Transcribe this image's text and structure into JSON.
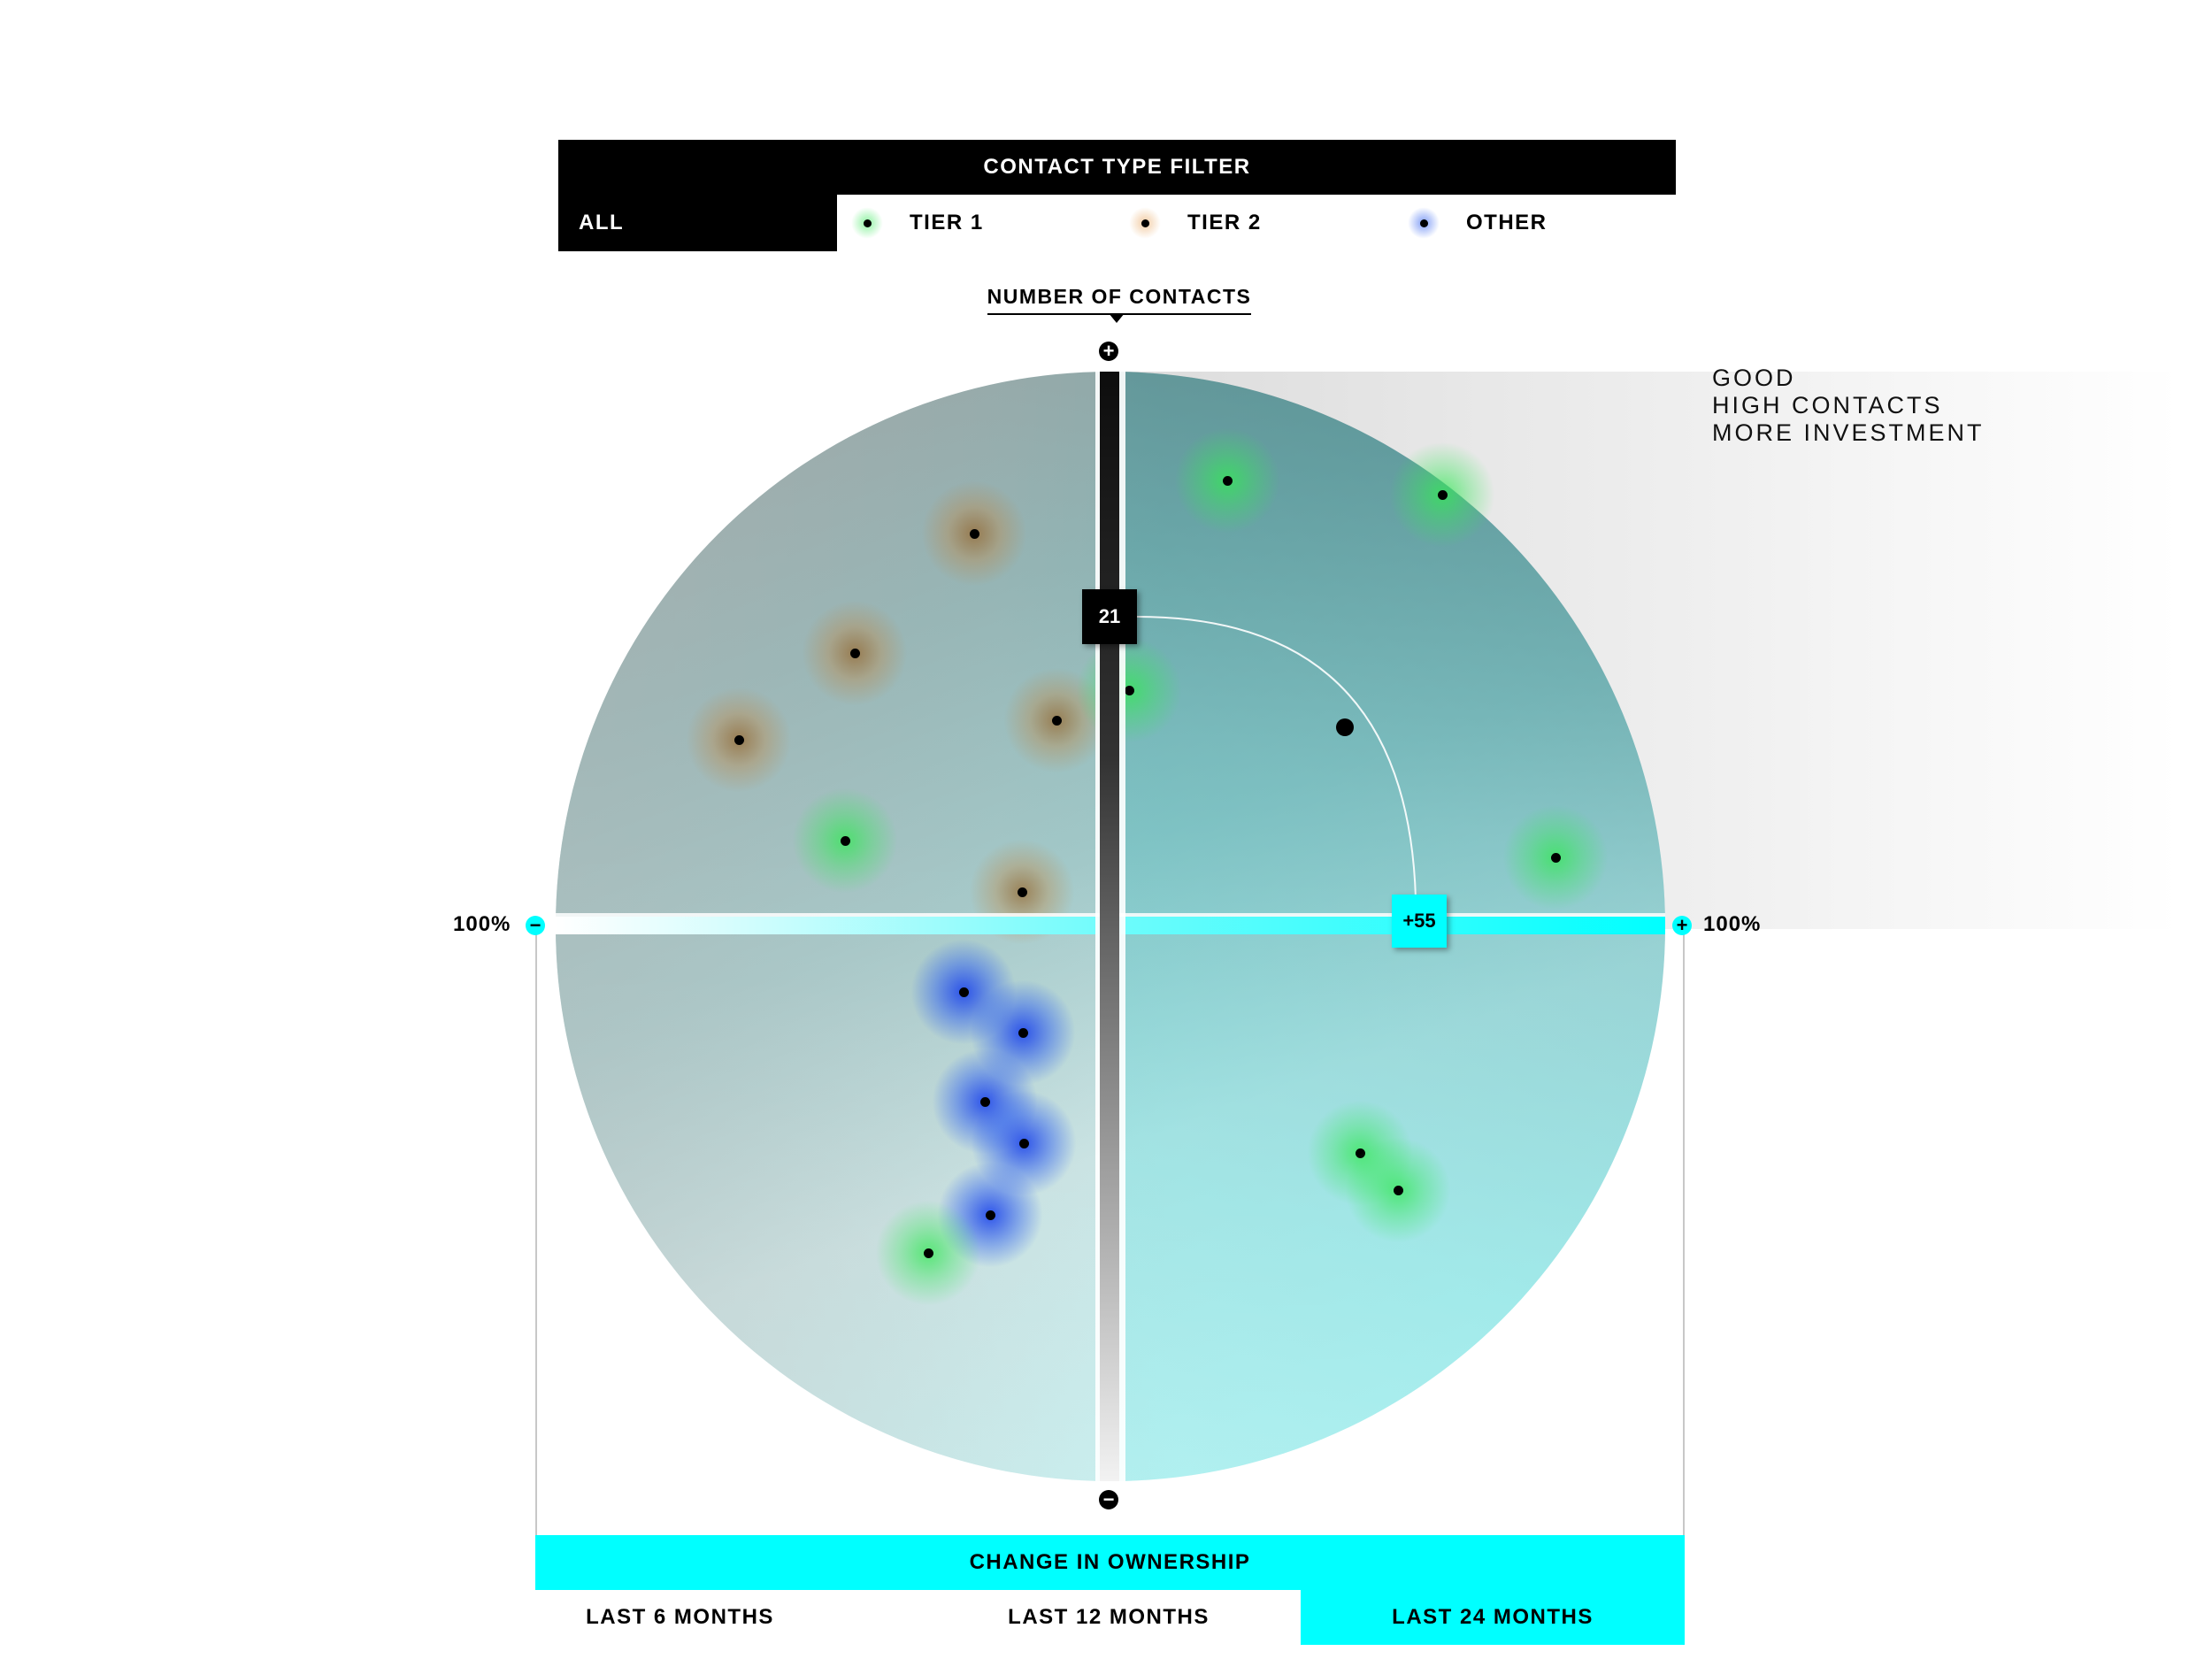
{
  "filter": {
    "title": "CONTACT TYPE FILTER",
    "all_label": "ALL",
    "options": [
      {
        "label": "TIER 1",
        "color": "#33e855"
      },
      {
        "label": "TIER 2",
        "color": "#e8a35a"
      },
      {
        "label": "OTHER",
        "color": "#2f5ff0"
      }
    ]
  },
  "y_axis": {
    "title": "NUMBER OF CONTACTS",
    "plus_symbol": "+",
    "minus_symbol": "−",
    "marker_value": "21"
  },
  "x_axis": {
    "title": "CHANGE IN OWNERSHIP",
    "left_label": "100%",
    "right_label": "100%",
    "plus_symbol": "+",
    "minus_symbol": "−",
    "marker_value": "+55"
  },
  "quadrant_hint": {
    "lines": [
      "GOOD",
      "HIGH CONTACTS",
      "MORE INVESTMENT"
    ]
  },
  "time_ranges": {
    "options": [
      "LAST 6 MONTHS",
      "LAST 12 MONTHS",
      "LAST 24 MONTHS"
    ],
    "selected": "LAST 24 MONTHS"
  },
  "colors": {
    "accent": "#00ffff",
    "tier1": "#33e855",
    "tier2": "#e8a35a",
    "other": "#2f5ff0",
    "dark": "#000000"
  }
}
